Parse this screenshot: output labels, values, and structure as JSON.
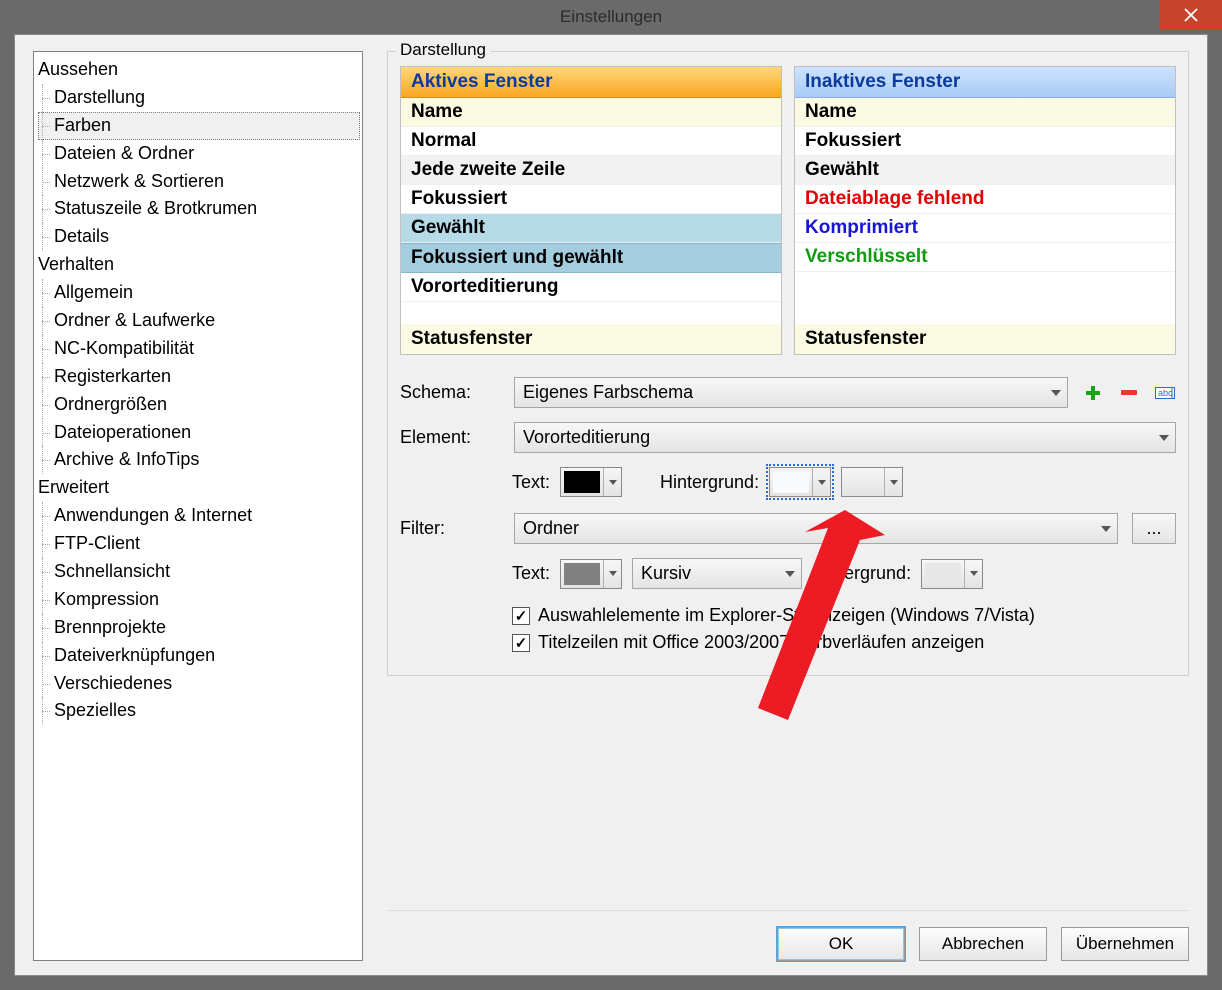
{
  "window": {
    "title": "Einstellungen"
  },
  "tree": {
    "categories": [
      {
        "label": "Aussehen",
        "items": [
          "Darstellung",
          "Farben",
          "Dateien & Ordner",
          "Netzwerk & Sortieren",
          "Statuszeile & Brotkrumen",
          "Details"
        ],
        "selected": "Farben"
      },
      {
        "label": "Verhalten",
        "items": [
          "Allgemein",
          "Ordner & Laufwerke",
          "NC-Kompatibilität",
          "Registerkarten",
          "Ordnergrößen",
          "Dateioperationen",
          "Archive & InfoTips"
        ]
      },
      {
        "label": "Erweitert",
        "items": [
          "Anwendungen & Internet",
          "FTP-Client",
          "Schnellansicht",
          "Kompression",
          "Brennprojekte",
          "Dateiverknüpfungen",
          "Verschiedenes",
          "Spezielles"
        ]
      }
    ]
  },
  "group": {
    "title": "Darstellung"
  },
  "panes": {
    "active": {
      "header": "Aktives Fenster",
      "rows": [
        "Name",
        "Normal",
        "Jede zweite Zeile",
        "Fokussiert",
        "Gewählt",
        "Fokussiert und gewählt",
        "Vororteditierung"
      ],
      "status": "Statusfenster"
    },
    "inactive": {
      "header": "Inaktives Fenster",
      "rows": [
        "Name",
        "Fokussiert",
        "Gewählt",
        "Dateiablage fehlend",
        "Komprimiert",
        "Verschlüsselt"
      ],
      "status": "Statusfenster"
    }
  },
  "form": {
    "schema_label": "Schema:",
    "schema_value": "Eigenes Farbschema",
    "element_label": "Element:",
    "element_value": "Vororteditierung",
    "text_label": "Text:",
    "bg_label": "Hintergrund:",
    "filter_label": "Filter:",
    "filter_value": "Ordner",
    "font_style_value": "Kursiv",
    "checkbox1": "Auswahlelemente im Explorer-Stil anzeigen (Windows 7/Vista)",
    "checkbox2": "Titelzeilen mit Office 2003/2007-Farbverläufen anzeigen"
  },
  "colors": {
    "element_text": "#000000",
    "element_bg": "#f9fafb",
    "filter_text": "#808080",
    "filter_bg": "#e8e8e8"
  },
  "buttons": {
    "ok": "OK",
    "cancel": "Abbrechen",
    "apply": "Übernehmen",
    "dots": "..."
  }
}
